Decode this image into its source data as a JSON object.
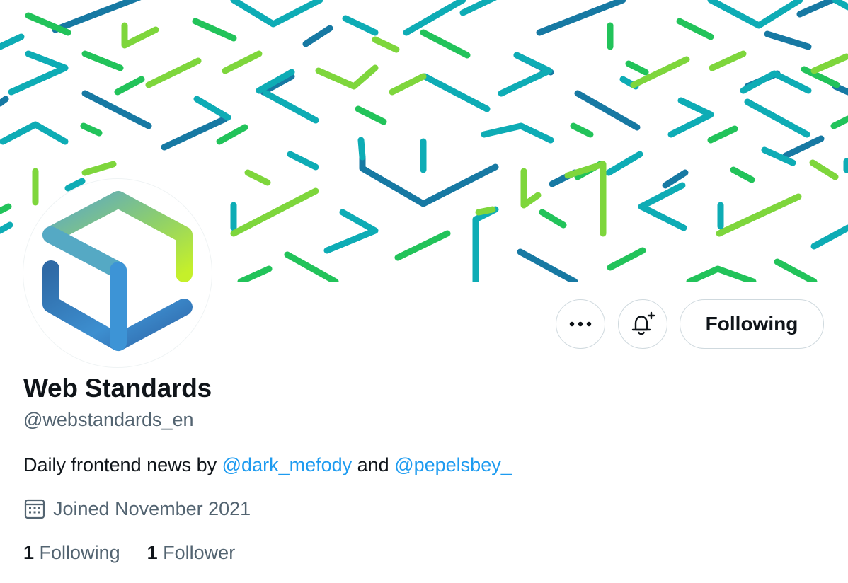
{
  "profile": {
    "name": "Web Standards",
    "handle": "@webstandards_en",
    "bio": {
      "prefix": "Daily frontend news by ",
      "mention1": "@dark_mefody",
      "middle": " and ",
      "mention2": "@pepelsbey_"
    },
    "joined": "Joined November 2021"
  },
  "actions": {
    "more_icon": "more-icon",
    "bell_icon": "bell-plus-icon",
    "follow_label": "Following"
  },
  "stats": {
    "following_count": "1",
    "following_label": "Following",
    "followers_count": "1",
    "followers_label": "Follower"
  },
  "colors": {
    "text": "#0f1419",
    "secondary": "#536471",
    "link": "#1d9bf0",
    "banner_dark_blue": "#1779a3",
    "banner_teal": "#0eacb5",
    "banner_green": "#22c35a",
    "banner_lime": "#7ed63c"
  }
}
